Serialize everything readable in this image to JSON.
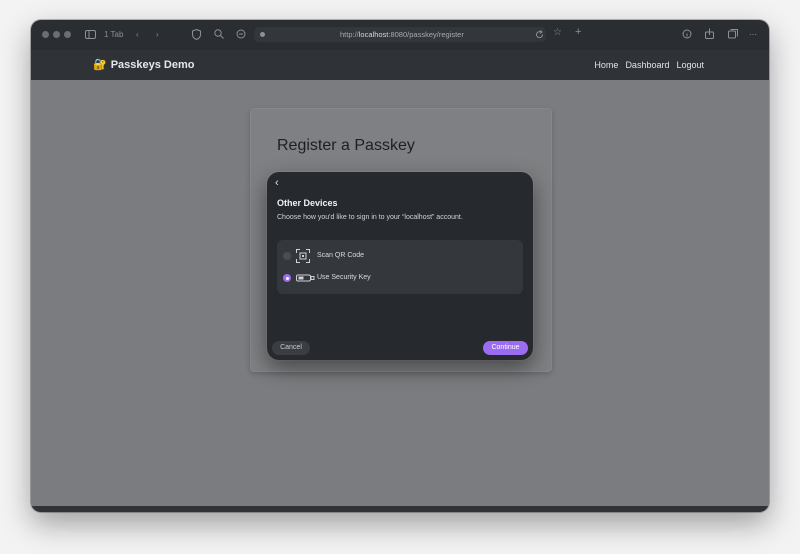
{
  "browser": {
    "tab_count": "1 Tab",
    "url_prefix": "http://",
    "url_host": "localhost",
    "url_rest": ":8080/passkey/register"
  },
  "app": {
    "brand": "Passkeys Demo",
    "nav": [
      "Home",
      "Dashboard",
      "Logout"
    ]
  },
  "page": {
    "title": "Register a Passkey"
  },
  "dialog": {
    "title": "Other Devices",
    "subtitle": "Choose how you'd like to sign in to your “localhost” account.",
    "options": [
      {
        "label": "Scan QR Code",
        "selected": false,
        "icon": "qr-code-icon"
      },
      {
        "label": "Use Security Key",
        "selected": true,
        "icon": "security-key-icon"
      }
    ],
    "cancel_label": "Cancel",
    "continue_label": "Continue"
  },
  "colors": {
    "accent": "#9b6cf0",
    "toolbar": "#2a2d31",
    "navbar": "#2f3338",
    "dialog_bg": "#26292d"
  }
}
